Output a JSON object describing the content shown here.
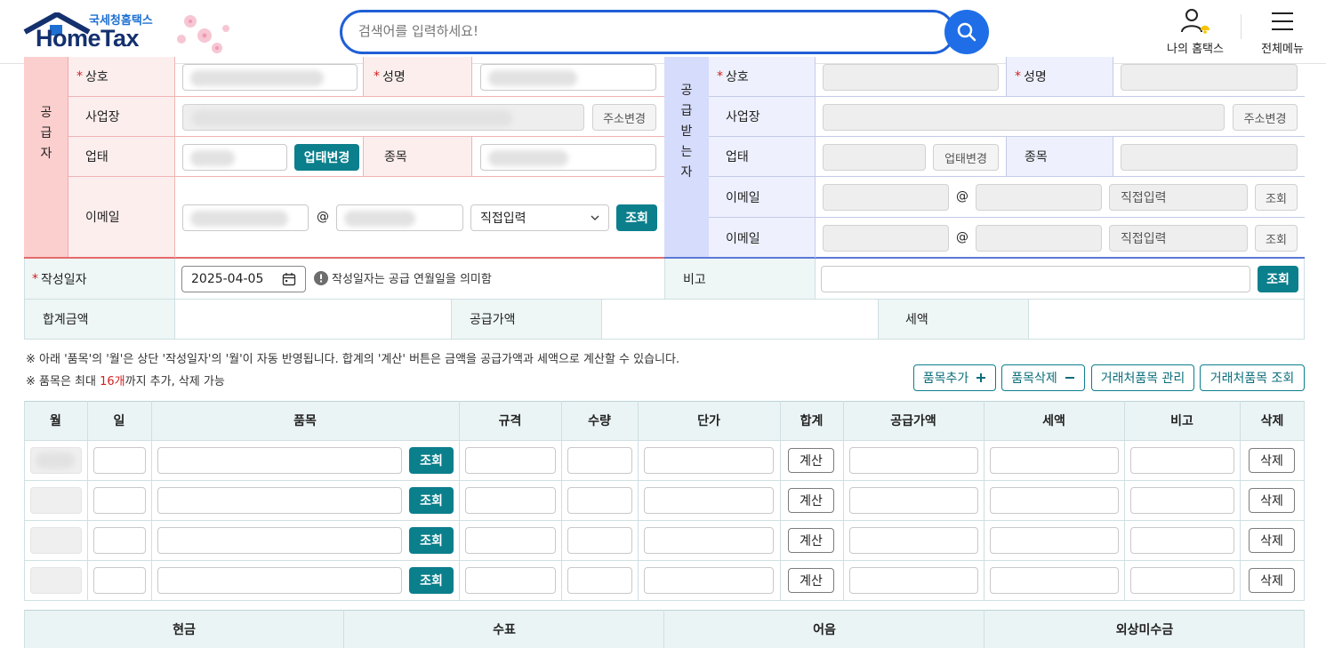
{
  "header": {
    "logo_sub": "국세청홈택스",
    "logo_main": "HomeTax",
    "search_placeholder": "검색어를 입력하세요!",
    "my_hometax": "나의 홈택스",
    "all_menu": "전체메뉴"
  },
  "supplier": {
    "side_label": [
      "공",
      "급",
      "자"
    ],
    "company_label": "상호",
    "name_label": "성명",
    "address_label": "사업장",
    "address_change": "주소변경",
    "business_type_label": "업태",
    "business_type_change": "업태변경",
    "item_label": "종목",
    "email_label": "이메일",
    "at": "@",
    "email_domain_select": "직접입력",
    "lookup": "조회"
  },
  "receiver": {
    "side_label": [
      "공",
      "급",
      "받",
      "는",
      "자"
    ],
    "company_label": "상호",
    "name_label": "성명",
    "address_label": "사업장",
    "address_change": "주소변경",
    "business_type_label": "업태",
    "business_type_change": "업태변경",
    "item_label": "종목",
    "email1_label": "이메일",
    "email2_label": "이메일",
    "at": "@",
    "email_domain_select": "직접입력",
    "lookup": "조회"
  },
  "invoice": {
    "date_label": "작성일자",
    "date_value": "2025-04-05",
    "date_note": "작성일자는 공급 연월일을 의미함",
    "remark_label": "비고",
    "remark_lookup": "조회",
    "total_label": "합계금액",
    "supply_label": "공급가액",
    "tax_label": "세액"
  },
  "notes": {
    "line1": "※ 아래 '품목'의 '월'은 상단 '작성일자'의 '월'이 자동 반영됩니다. 합계의 '계산' 버튼은 금액을 공급가액과 세액으로 계산할 수 있습니다.",
    "line2_prefix": "※ 품목은 최대 ",
    "line2_count": "16개",
    "line2_suffix": "까지 추가, 삭제 가능"
  },
  "item_actions": {
    "add": "품목추가",
    "remove": "품목삭제",
    "manage": "거래처품목 관리",
    "lookup": "거래처품목 조회"
  },
  "items_table": {
    "headers": [
      "월",
      "일",
      "품목",
      "규격",
      "수량",
      "단가",
      "합계",
      "공급가액",
      "세액",
      "비고",
      "삭제"
    ],
    "row_lookup": "조회",
    "row_calc": "계산",
    "row_delete": "삭제",
    "row_count": 4
  },
  "payment": {
    "headers": [
      "현금",
      "수표",
      "어음",
      "외상미수금"
    ]
  },
  "colors": {
    "teal": "#0b7f8c",
    "supplier_pink": "#fccfcf",
    "receiver_blue": "#d6dcfb",
    "accent_blue": "#1f5fd6",
    "required_red": "#d21e1e"
  }
}
